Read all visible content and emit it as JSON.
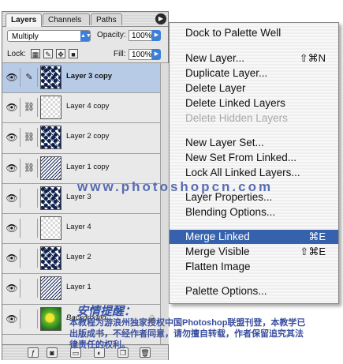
{
  "palette": {
    "tabs": [
      "Layers",
      "Channels",
      "Paths"
    ],
    "blend_mode": "Multiply",
    "opacity_label": "Opacity:",
    "opacity_value": "100%",
    "lock_label": "Lock:",
    "fill_label": "Fill:",
    "fill_value": "100%",
    "layers": [
      {
        "name": "Layer 3 copy",
        "selected": true
      },
      {
        "name": "Layer 4 copy",
        "selected": false
      },
      {
        "name": "Layer 2 copy",
        "selected": false
      },
      {
        "name": "Layer 1 copy",
        "selected": false
      },
      {
        "name": "Layer 3",
        "selected": false
      },
      {
        "name": "Layer 4",
        "selected": false
      },
      {
        "name": "Layer 2",
        "selected": false
      },
      {
        "name": "Layer 1",
        "selected": false
      },
      {
        "name": "Background",
        "selected": false
      }
    ]
  },
  "menu": {
    "items": [
      {
        "label": "Dock to Palette Well",
        "shortcut": ""
      },
      {
        "label": "New Layer...",
        "shortcut": "⇧⌘N"
      },
      {
        "label": "Duplicate Layer...",
        "shortcut": ""
      },
      {
        "label": "Delete Layer",
        "shortcut": ""
      },
      {
        "label": "Delete Linked Layers",
        "shortcut": ""
      },
      {
        "label": "Delete Hidden Layers",
        "shortcut": "",
        "disabled": true
      },
      {
        "label": "New Layer Set...",
        "shortcut": ""
      },
      {
        "label": "New Set From Linked...",
        "shortcut": ""
      },
      {
        "label": "Lock All Linked Layers...",
        "shortcut": ""
      },
      {
        "label": "Layer Properties...",
        "shortcut": ""
      },
      {
        "label": "Blending Options...",
        "shortcut": ""
      },
      {
        "label": "Merge Linked",
        "shortcut": "⌘E",
        "highlighted": true
      },
      {
        "label": "Merge Visible",
        "shortcut": "⇧⌘E"
      },
      {
        "label": "Flatten Image",
        "shortcut": ""
      },
      {
        "label": "Palette Options...",
        "shortcut": ""
      }
    ]
  },
  "watermark": {
    "url": "www.photoshopcn.com",
    "title": "安情提醒：",
    "notice": "本教程为游浪州独家授权中国Photoshop联盟刊登，本教学已出版成书，不经作者同意，请勿擅自转载，作者保留追究其法律责任的权利。"
  },
  "colors": {
    "selected_layer": "#b7cbe6",
    "menu_highlight": "#3561ad",
    "watermark": "#3e56a8"
  }
}
